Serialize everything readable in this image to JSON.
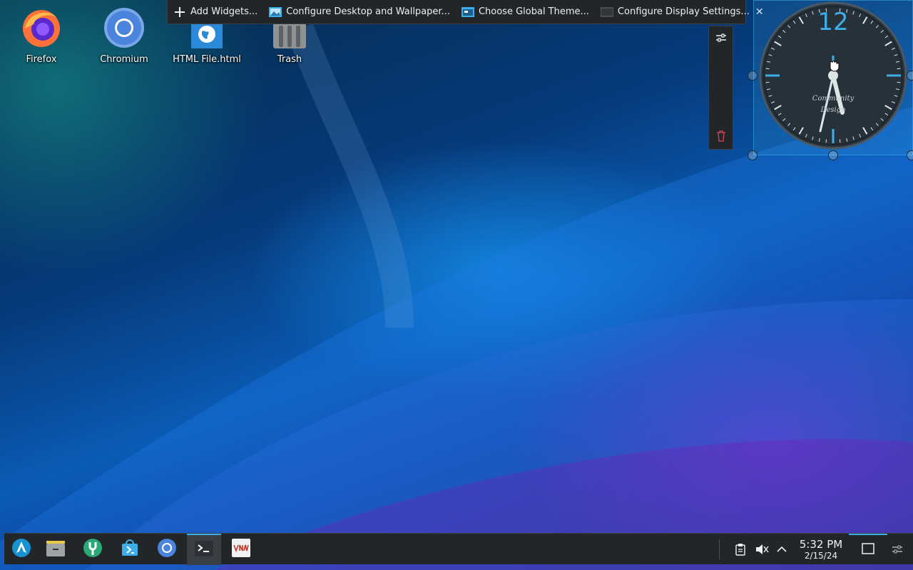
{
  "desktop": {
    "icons": [
      {
        "label": "Firefox"
      },
      {
        "label": "Chromium"
      },
      {
        "label": "HTML File.html"
      },
      {
        "label": "Trash"
      }
    ]
  },
  "toolbar": {
    "add_widgets": "Add Widgets...",
    "configure_desktop": "Configure Desktop and Wallpaper...",
    "global_theme": "Choose Global Theme...",
    "display_settings": "Configure Display Settings..."
  },
  "clock_widget": {
    "twelve": "12",
    "brand_line1": "Community",
    "brand_line2": "Design",
    "accent": "#3daee9"
  },
  "taskbar": {
    "apps": [
      "launcher-icon",
      "file-manager-icon",
      "system-settings-icon",
      "discover-store-icon",
      "chromium-icon",
      "terminal-icon",
      "vnc-icon"
    ],
    "time": "5:32 PM",
    "date": "2/15/24"
  }
}
